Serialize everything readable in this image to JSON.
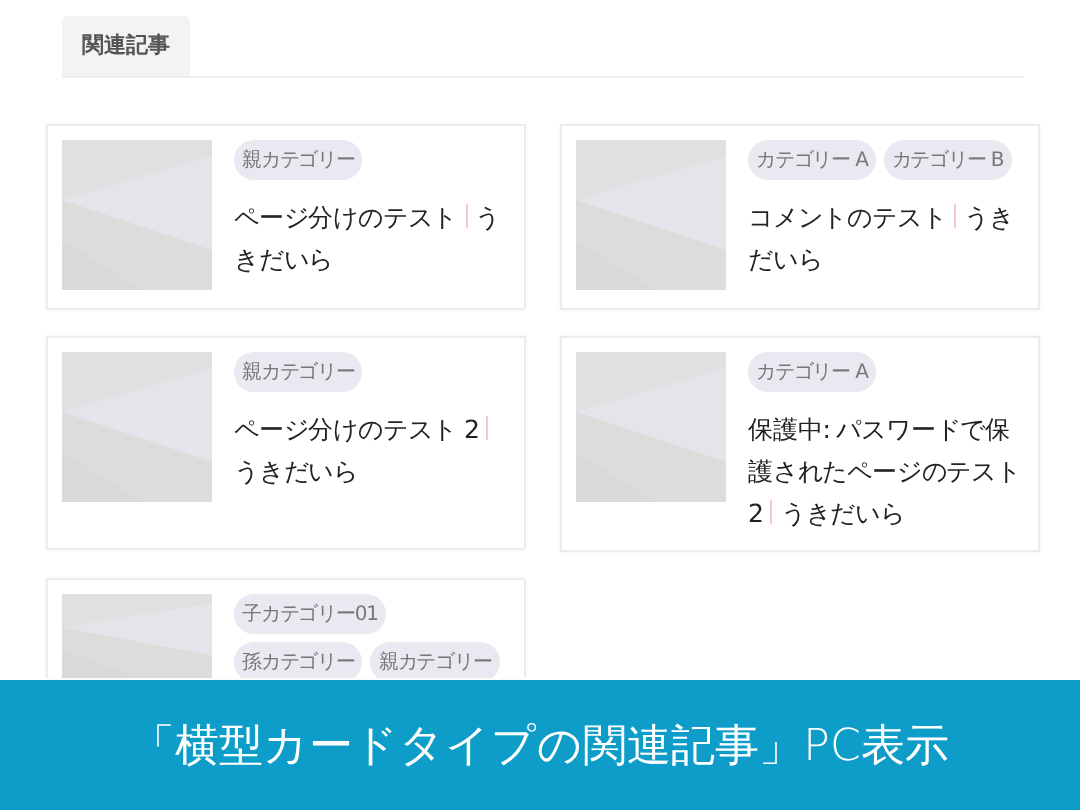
{
  "section": {
    "heading": "関連記事"
  },
  "posts": [
    {
      "thumbnail": {
        "kind": "picture"
      },
      "tags": [
        "親カテゴリー"
      ],
      "title": "ページ分けのテスト",
      "author": "うきだいら"
    },
    {
      "thumbnail": {
        "kind": "picture"
      },
      "tags": [
        "カテゴリー A",
        "カテゴリー B"
      ],
      "title": "コメントのテスト",
      "author": "うきだいら"
    },
    {
      "thumbnail": {
        "kind": "picture"
      },
      "tags": [
        "親カテゴリー"
      ],
      "title": "ページ分けのテスト 2",
      "author": "うきだいら"
    },
    {
      "thumbnail": {
        "kind": "picture"
      },
      "tags": [
        "カテゴリー A"
      ],
      "title": "保護中: パスワードで保護されたページのテスト2",
      "author": "うきだいら"
    },
    {
      "thumbnail": {
        "kind": "picture"
      },
      "tags": [
        "子カテゴリー01",
        "孫カテゴリー",
        "親カテゴリー"
      ]
    }
  ],
  "caption": "「横型カードタイプの関連記事」PC表示"
}
